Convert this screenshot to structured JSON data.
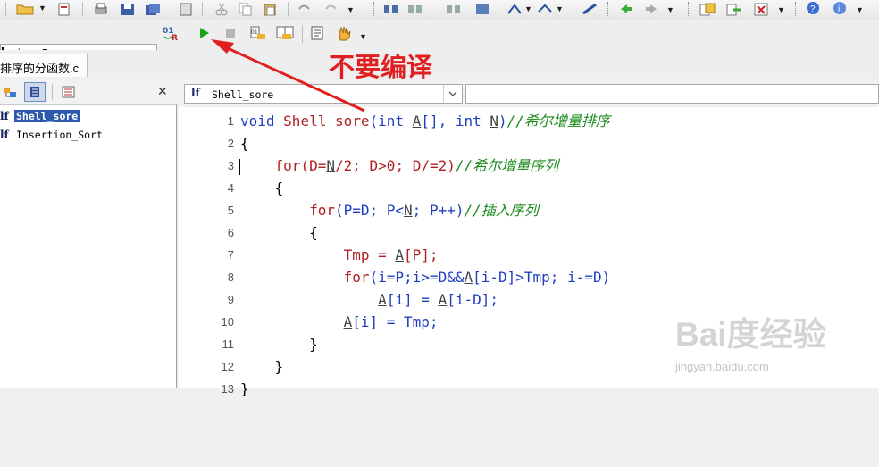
{
  "toolbar": {
    "compiler_value": "mingw5"
  },
  "file_tab": {
    "label": "排序的分函数.c"
  },
  "left_panel": {
    "tree_items": [
      {
        "label": "Shell_sore",
        "selected": true
      },
      {
        "label": "Insertion_Sort",
        "selected": false
      }
    ]
  },
  "editor": {
    "function_selector": "Shell_sore",
    "lines": [
      {
        "num": "1"
      },
      {
        "num": "2"
      },
      {
        "num": "3"
      },
      {
        "num": "4"
      },
      {
        "num": "5"
      },
      {
        "num": "6"
      },
      {
        "num": "7"
      },
      {
        "num": "8"
      },
      {
        "num": "9"
      },
      {
        "num": "10"
      },
      {
        "num": "11"
      },
      {
        "num": "12"
      },
      {
        "num": "13"
      }
    ],
    "code": {
      "l1_kw1": "void ",
      "l1_fn": "Shell_sore",
      "l1_p1": "(",
      "l1_kw2": "int ",
      "l1_a": "A",
      "l1_p2": "[], ",
      "l1_kw3": "int ",
      "l1_n": "N",
      "l1_p3": ")",
      "l1_cm": "//希尔增量排序",
      "l2": "{",
      "l3_kw": "for",
      "l3_p1": "(D=",
      "l3_n": "N",
      "l3_p2": "/",
      "l3_num": "2",
      "l3_p3": "; D>",
      "l3_num2": "0",
      "l3_p4": "; D/=",
      "l3_num3": "2",
      "l3_p5": ")",
      "l3_cm": "//希尔增量序列",
      "l4": "{",
      "l5_kw": "for",
      "l5_p1": "(P=D; P<",
      "l5_n": "N",
      "l5_p2": "; P++)",
      "l5_cm": "//插入序列",
      "l6": "{",
      "l7_p1": "Tmp = ",
      "l7_a": "A",
      "l7_p2": "[P];",
      "l8_kw": "for",
      "l8_p1": "(i=P;i>=D&&",
      "l8_a": "A",
      "l8_p2": "[i-D]>Tmp; i-=D)",
      "l9_a1": "A",
      "l9_p1": "[i] = ",
      "l9_a2": "A",
      "l9_p2": "[i-D];",
      "l10_a": "A",
      "l10_p": "[i] = Tmp;",
      "l11": "}",
      "l12": "}",
      "l13": "}"
    }
  },
  "annotation": {
    "text": "不要编译",
    "color": "#e02020"
  },
  "watermark": {
    "logo": "Bai度经验",
    "url": "jingyan.baidu.com"
  },
  "icons": [
    "open-folder-icon",
    "save-icon",
    "undo-icon",
    "find-icon",
    "replace-icon",
    "run-icon",
    "stop-icon",
    "compile-icon",
    "debug-icon",
    "hand-icon",
    "help-icon",
    "x-icon"
  ]
}
